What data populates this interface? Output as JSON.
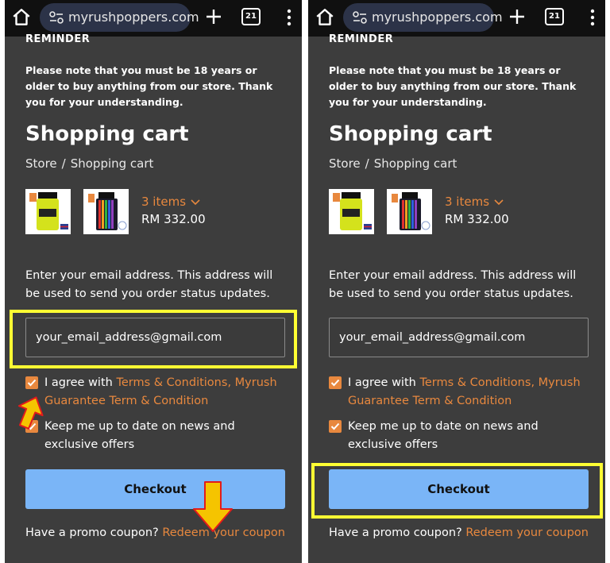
{
  "browser": {
    "url": "myrushpoppers.com",
    "tab_count": "21"
  },
  "page": {
    "reminder_heading": "REMINDER",
    "reminder_text": "Please note that you must be 18 years or older to buy anything from our store. Thank you for your understanding.",
    "title": "Shopping cart",
    "breadcrumb": [
      "Store",
      "Shopping cart"
    ],
    "breadcrumb_separator": "/"
  },
  "cart": {
    "items_count": "3 items",
    "total": "RM 332.00"
  },
  "checkout_form": {
    "email_description": "Enter your email address. This address will be used to send you order status updates.",
    "email_value": "your_email_address@gmail.com",
    "agree_prefix": "I agree with ",
    "terms_link": "Terms & Conditions",
    "terms_separator": ", ",
    "guarantee_link": "Myrush Guarantee Term & Condition",
    "newsletter_label": "Keep me up to date on news and exclusive offers",
    "checkout_label": "Checkout",
    "promo_prompt": "Have a promo coupon? ",
    "promo_link": "Redeem your coupon"
  },
  "colors": {
    "page_background": "#3d3d3d",
    "accent_orange": "#e8883e",
    "checkout_button": "#7ab5f7",
    "highlight_yellow": "#ffff33"
  },
  "icons": [
    "home-icon",
    "site-settings-icon",
    "new-tab-icon",
    "tab-switcher-icon",
    "more-vert-icon",
    "chevron-down-icon",
    "checkmark-icon",
    "arrow-up-icon",
    "arrow-down-icon"
  ]
}
